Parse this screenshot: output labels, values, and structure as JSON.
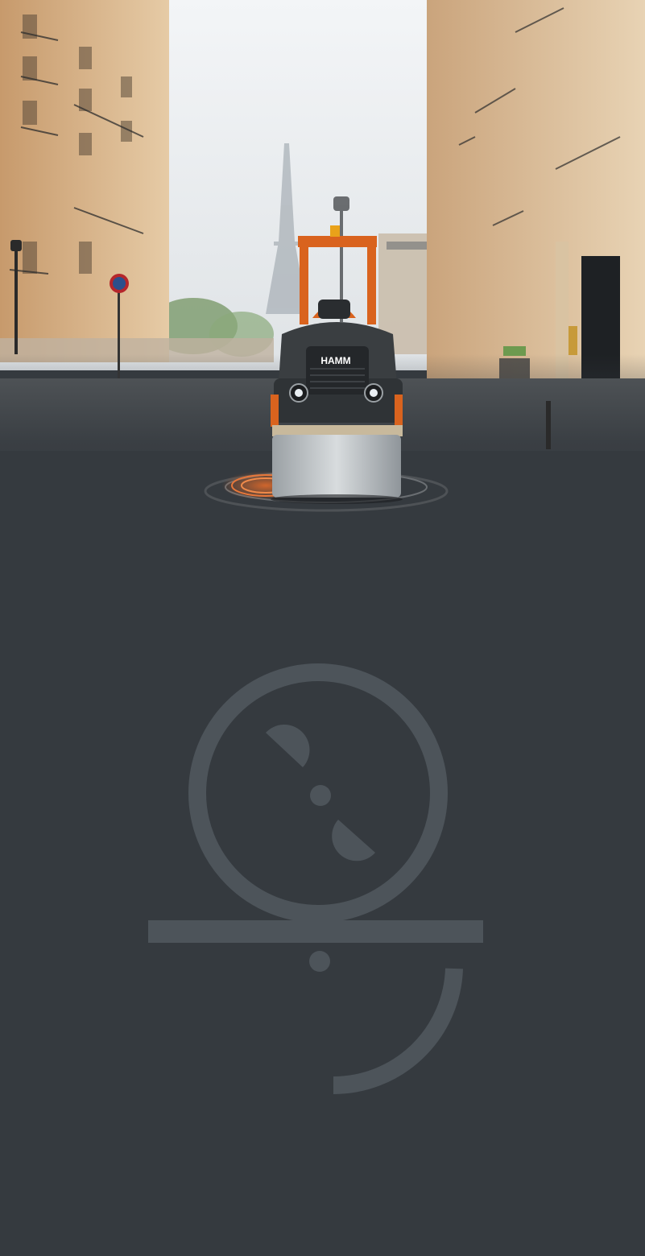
{
  "hero": {
    "machine_brand": "HAMM",
    "alt_scene": "street-scene-with-tandem-roller"
  },
  "emblem": {
    "icon": "compaction-logo-icon"
  },
  "colors": {
    "page_background": "#353a3f",
    "machine_orange": "#d9631e",
    "machine_dark": "#2f3336",
    "emblem_gray": "#4d545a",
    "sky": "#e9ecef",
    "stone": "#d9b995"
  }
}
